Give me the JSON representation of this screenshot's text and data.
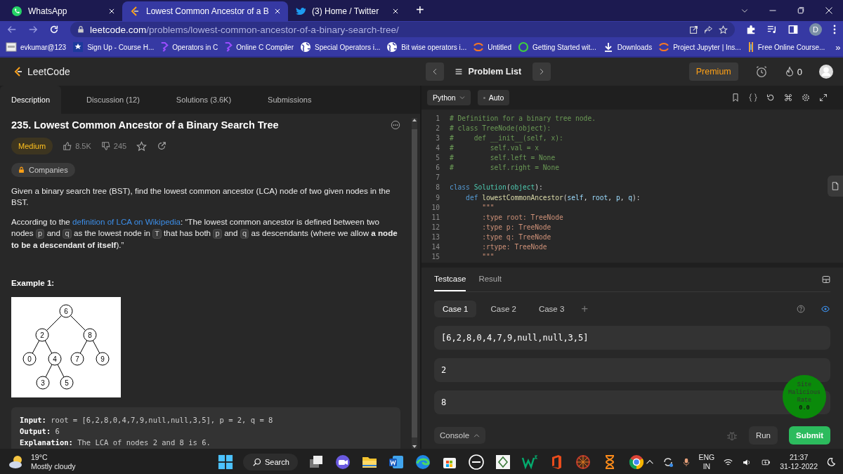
{
  "browser": {
    "tabs": [
      {
        "title": "WhatsApp",
        "selected": false
      },
      {
        "title": "Lowest Common Ancestor of a B",
        "selected": true
      },
      {
        "title": "(3) Home / Twitter",
        "selected": false
      }
    ],
    "new_tab": "+",
    "url_host": "leetcode.com",
    "url_path": "/problems/lowest-common-ancestor-of-a-binary-search-tree/",
    "profile": "D",
    "bookmarks": [
      "evkumar@123",
      "Sign Up - Course H...",
      "Operators in C",
      "Online C Compiler",
      "Special Operators i...",
      "Bit wise operators i...",
      "Untitled",
      "Getting Started wit...",
      "Downloads",
      "Project Jupyter | Ins...",
      "Free Online Course..."
    ],
    "bookmarks_more": "»"
  },
  "header": {
    "logo": "LeetCode",
    "nav": "Problem List",
    "premium": "Premium",
    "streak": "0"
  },
  "description_tabs": [
    {
      "label": "Description",
      "selected": true
    },
    {
      "label": "Discussion (12)",
      "selected": false
    },
    {
      "label": "Solutions (3.6K)",
      "selected": false
    },
    {
      "label": "Submissions",
      "selected": false
    }
  ],
  "problem": {
    "title": "235. Lowest Common Ancestor of a Binary Search Tree",
    "difficulty": "Medium",
    "likes": "8.5K",
    "dislikes": "245",
    "companies": "Companies",
    "intro": "Given a binary search tree (BST), find the lowest common ancestor (LCA) node of two given nodes in the BST.",
    "paragraph": [
      {
        "kind": "text",
        "text": "According to the "
      },
      {
        "kind": "link",
        "text": "definition of LCA on Wikipedia"
      },
      {
        "kind": "text",
        "text": ": “The lowest common ancestor is defined between two nodes "
      },
      {
        "kind": "code",
        "text": "p"
      },
      {
        "kind": "text",
        "text": " and "
      },
      {
        "kind": "code",
        "text": "q"
      },
      {
        "kind": "text",
        "text": " as the lowest node in "
      },
      {
        "kind": "code",
        "text": "T"
      },
      {
        "kind": "text",
        "text": " that has both "
      },
      {
        "kind": "code",
        "text": "p"
      },
      {
        "kind": "text",
        "text": " and "
      },
      {
        "kind": "code",
        "text": "q"
      },
      {
        "kind": "text",
        "text": " as descendants (where we allow "
      },
      {
        "kind": "bold",
        "text": "a node to be a descendant of itself"
      },
      {
        "kind": "text",
        "text": ").”"
      }
    ],
    "example_title": "Example 1:",
    "tree": {
      "value": "6",
      "children": [
        {
          "value": "2",
          "children": [
            {
              "value": "0"
            },
            {
              "value": "4",
              "children": [
                {
                  "value": "3"
                },
                {
                  "value": "5"
                }
              ]
            }
          ]
        },
        {
          "value": "8",
          "children": [
            {
              "value": "7"
            },
            {
              "value": "9"
            }
          ]
        }
      ]
    },
    "example": [
      {
        "label": "Input:",
        "value": "root = [6,2,8,0,4,7,9,null,null,3,5], p = 2, q = 8"
      },
      {
        "label": "Output:",
        "value": "6"
      },
      {
        "label": "Explanation:",
        "value": "The LCA of nodes 2 and 8 is 6."
      }
    ]
  },
  "editor": {
    "language": "Python",
    "mode": "Auto",
    "lines": [
      {
        "number": "1",
        "tokens": [
          {
            "kind": "comment",
            "text": "# Definition for a binary tree node."
          }
        ]
      },
      {
        "number": "2",
        "tokens": [
          {
            "kind": "comment",
            "text": "# class TreeNode(object):"
          }
        ]
      },
      {
        "number": "3",
        "tokens": [
          {
            "kind": "comment",
            "text": "#     def __init__(self, x):"
          }
        ]
      },
      {
        "number": "4",
        "tokens": [
          {
            "kind": "comment",
            "text": "#         self.val = x"
          }
        ]
      },
      {
        "number": "5",
        "tokens": [
          {
            "kind": "comment",
            "text": "#         self.left = None"
          }
        ]
      },
      {
        "number": "6",
        "tokens": [
          {
            "kind": "comment",
            "text": "#         self.right = None"
          }
        ]
      },
      {
        "number": "7"
      },
      {
        "number": "8",
        "tokens": [
          {
            "kind": "keyword",
            "text": "class "
          },
          {
            "kind": "type",
            "text": "Solution"
          },
          {
            "kind": "plain",
            "text": "("
          },
          {
            "kind": "type",
            "text": "object"
          },
          {
            "kind": "plain",
            "text": "):"
          }
        ]
      },
      {
        "number": "9",
        "tokens": [
          {
            "kind": "keyword",
            "text": "    def "
          },
          {
            "kind": "function",
            "text": "lowestCommonAncestor"
          },
          {
            "kind": "plain",
            "text": "("
          },
          {
            "kind": "variable",
            "text": "self"
          },
          {
            "kind": "plain",
            "text": ", "
          },
          {
            "kind": "variable",
            "text": "root"
          },
          {
            "kind": "plain",
            "text": ", "
          },
          {
            "kind": "variable",
            "text": "p"
          },
          {
            "kind": "plain",
            "text": ", "
          },
          {
            "kind": "variable",
            "text": "q"
          },
          {
            "kind": "plain",
            "text": "):"
          }
        ]
      },
      {
        "number": "10",
        "tokens": [
          {
            "kind": "string",
            "text": "        \"\"\""
          }
        ]
      },
      {
        "number": "11",
        "tokens": [
          {
            "kind": "string",
            "text": "        :type root: TreeNode"
          }
        ]
      },
      {
        "number": "12",
        "tokens": [
          {
            "kind": "string",
            "text": "        :type p: TreeNode"
          }
        ]
      },
      {
        "number": "13",
        "tokens": [
          {
            "kind": "string",
            "text": "        :type q: TreeNode"
          }
        ]
      },
      {
        "number": "14",
        "tokens": [
          {
            "kind": "string",
            "text": "        :rtype: TreeNode"
          }
        ]
      },
      {
        "number": "15",
        "tokens": [
          {
            "kind": "string",
            "text": "        \"\"\""
          }
        ]
      }
    ]
  },
  "testcase": {
    "tabs": [
      {
        "label": "Testcase",
        "selected": true
      },
      {
        "label": "Result",
        "selected": false
      }
    ],
    "cases": [
      {
        "label": "Case 1",
        "selected": true
      },
      {
        "label": "Case 2",
        "selected": false
      },
      {
        "label": "Case 3",
        "selected": false
      }
    ],
    "add": "+",
    "inputs": [
      "[6,2,8,0,4,7,9,null,null,3,5]",
      "2",
      "8"
    ],
    "console": "Console",
    "run": "Run",
    "submit": "Submit"
  },
  "malicious_badge": {
    "lines": [
      "Site",
      "Malicious",
      "Rate"
    ],
    "score": "0.0"
  },
  "taskbar": {
    "temperature": "19°C",
    "weather": "Mostly cloudy",
    "search": "Search",
    "language": "ENG",
    "region": "IN",
    "time": "21:37",
    "date": "31-12-2022"
  }
}
